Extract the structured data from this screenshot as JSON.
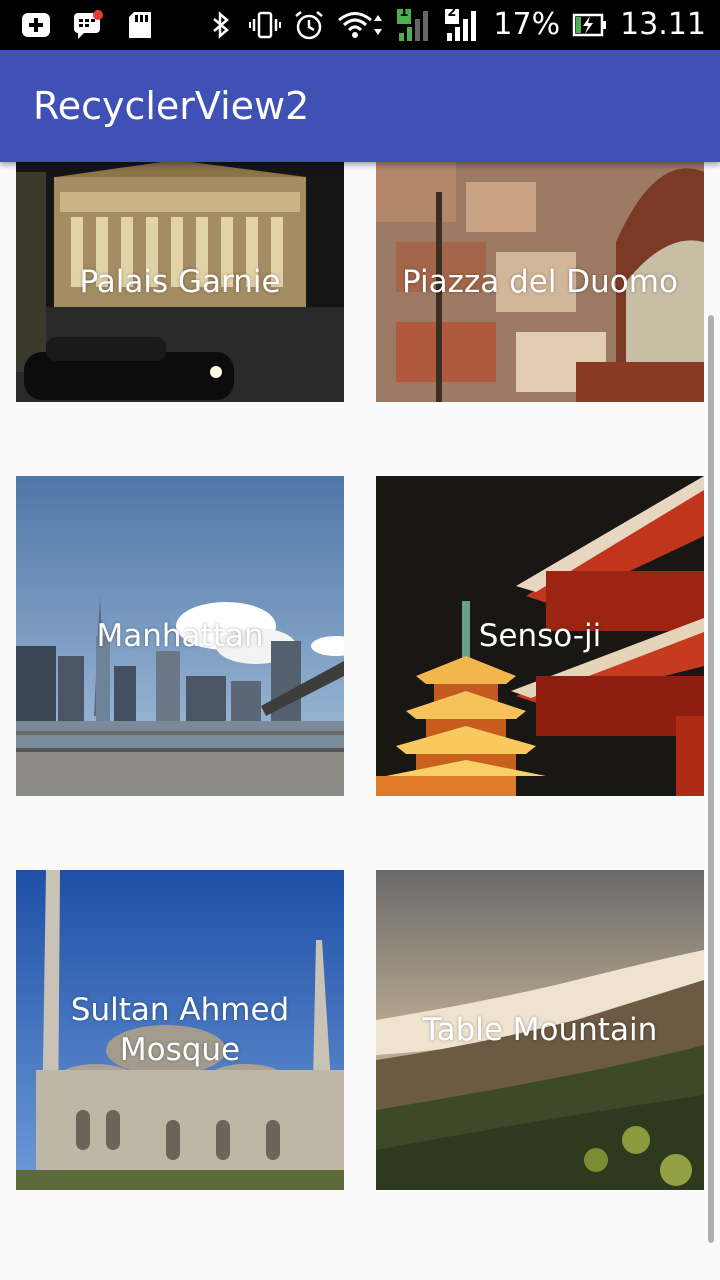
{
  "status_bar": {
    "icons_left": [
      "add-box-icon",
      "bbm-icon",
      "sd-card-icon"
    ],
    "icons_right": [
      "bluetooth-icon",
      "vibrate-icon",
      "alarm-icon",
      "wifi-icon",
      "sim1-signal-icon",
      "sim2-signal-icon"
    ],
    "sim1": "1",
    "sim2": "2",
    "battery_percent": "17%",
    "time": "13.11"
  },
  "app_bar": {
    "title": "RecyclerView2",
    "color": "#3f51b5"
  },
  "places": [
    {
      "label": "Palais Garnie",
      "scene": "opera-house-night"
    },
    {
      "label": "Piazza del Duomo",
      "scene": "city-rooftops"
    },
    {
      "label": "Manhattan",
      "scene": "skyline-day"
    },
    {
      "label": "Senso-ji",
      "scene": "pagoda-night"
    },
    {
      "label": "Sultan Ahmed Mosque",
      "scene": "mosque-minarets"
    },
    {
      "label": "Table Mountain",
      "scene": "mountain-clouds"
    }
  ]
}
